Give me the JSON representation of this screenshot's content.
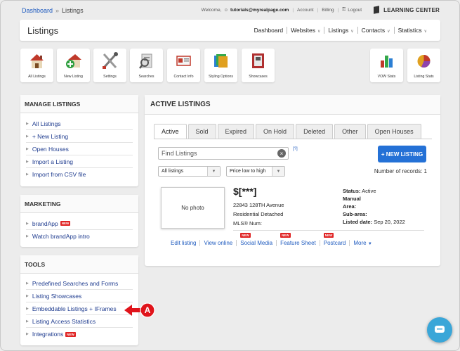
{
  "topbar": {
    "breadcrumb": [
      "Dashboard",
      "Listings"
    ],
    "welcome": "Welcome,",
    "user": "tutorials@myrealpage.com",
    "links": [
      "Account",
      "Billing",
      "Logout"
    ],
    "learning_center": "LEARNING CENTER"
  },
  "header": {
    "title": "Listings",
    "nav": [
      "Dashboard",
      "Websites",
      "Listings",
      "Contacts",
      "Statistics"
    ]
  },
  "tiles": [
    {
      "label": "All Listings",
      "icon": "house-icon"
    },
    {
      "label": "New Listing",
      "icon": "add-house-icon"
    },
    {
      "label": "Settings",
      "icon": "tools-icon"
    },
    {
      "label": "Searches",
      "icon": "magnifier-docs-icon"
    },
    {
      "label": "Contact Info",
      "icon": "contact-card-icon"
    },
    {
      "label": "Styling Options",
      "icon": "palette-icon"
    },
    {
      "label": "Showcases",
      "icon": "showcase-icon"
    },
    {
      "label": "VOW Stats",
      "icon": "bar-chart-icon"
    },
    {
      "label": "Listing Stats",
      "icon": "pie-chart-icon"
    }
  ],
  "manage": {
    "title": "MANAGE LISTINGS",
    "items": [
      "All Listings",
      "+ New Listing",
      "Open Houses",
      "Import a Listing",
      "Import from CSV file"
    ]
  },
  "marketing": {
    "title": "MARKETING",
    "items": [
      "brandApp",
      "Watch brandApp intro"
    ],
    "badge": "NEW"
  },
  "tools": {
    "title": "TOOLS",
    "items": [
      "Predefined Searches and Forms",
      "Listing Showcases",
      "Embeddable Listings + IFrames",
      "Listing Access Statistics",
      "Integrations"
    ],
    "badge": "NEW"
  },
  "active": {
    "title": "ACTIVE LISTINGS",
    "tabs": [
      "Active",
      "Sold",
      "Expired",
      "On Hold",
      "Deleted",
      "Other",
      "Open Houses"
    ],
    "search_placeholder": "Find Listings",
    "help_mark": "[?]",
    "new_listing": "+ NEW LISTING",
    "filter": "All listings",
    "sort": "Price low to high",
    "records": "Number of records: 1"
  },
  "listing": {
    "photo": "No photo",
    "price": "$[***]",
    "address": "22843 128TH Avenue",
    "type": "Residential Detached",
    "mls": "MLS® Num:",
    "status_label": "Status:",
    "status": "Active",
    "manual": "Manual",
    "area_label": "Area:",
    "subarea_label": "Sub-area:",
    "listed_label": "Listed date:",
    "listed_date": "Sep 20, 2022",
    "actions": [
      "Edit listing",
      "View online",
      "Social Media",
      "Feature Sheet",
      "Postcard",
      "More"
    ],
    "badge": "NEW"
  },
  "callout": "A",
  "colors": {
    "link": "#1f3c8f",
    "accent": "#2471d6",
    "badge": "#e02424",
    "callout": "#e0141b",
    "help": "#3aa6d8"
  }
}
